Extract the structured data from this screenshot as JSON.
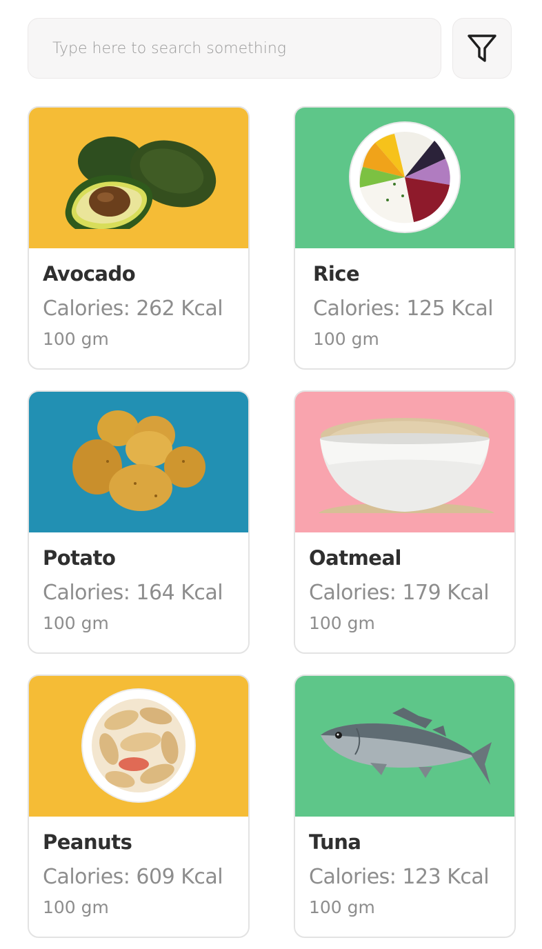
{
  "search": {
    "placeholder": "Type here to search something"
  },
  "filter": {
    "icon": "funnel-icon"
  },
  "foods": [
    {
      "name": "Avocado",
      "calories": "Calories: 262 Kcal",
      "serving": "100 gm",
      "bg": "#F5BC36",
      "icon": "avocado-image"
    },
    {
      "name": "Rice",
      "calories": "Calories: 125 Kcal",
      "serving": "100 gm",
      "bg": "#5EC689",
      "icon": "rice-bowl-image"
    },
    {
      "name": "Potato",
      "calories": "Calories: 164 Kcal",
      "serving": "100 gm",
      "bg": "#2290B3",
      "icon": "potato-image"
    },
    {
      "name": "Oatmeal",
      "calories": "Calories: 179 Kcal",
      "serving": "100 gm",
      "bg": "#F9A4AE",
      "icon": "oatmeal-bowl-image"
    },
    {
      "name": "Peanuts",
      "calories": "Calories: 609 Kcal",
      "serving": "100 gm",
      "bg": "#F5BC36",
      "icon": "peanuts-bowl-image"
    },
    {
      "name": "Tuna",
      "calories": "Calories: 123 Kcal",
      "serving": "100 gm",
      "bg": "#5EC689",
      "icon": "fish-image"
    }
  ]
}
